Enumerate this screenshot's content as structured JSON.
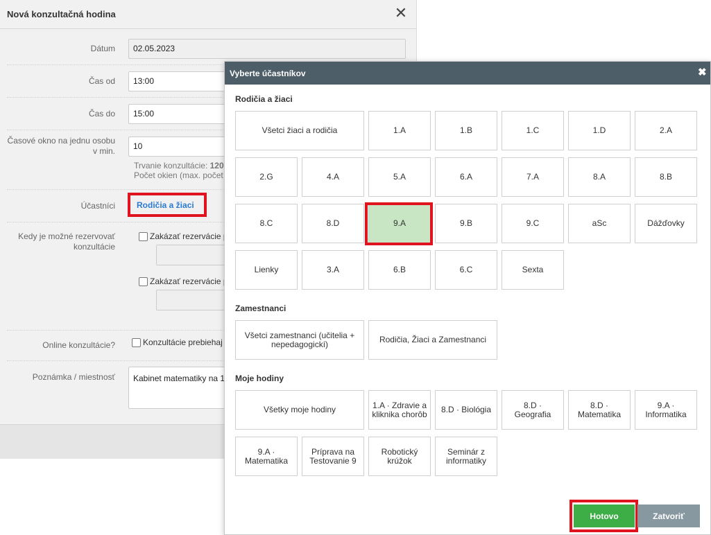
{
  "base": {
    "title": "Nová konzultačná hodina",
    "date_label": "Dátum",
    "date_value": "02.05.2023",
    "time_from_label": "Čas od",
    "time_from_value": "13:00",
    "time_to_label": "Čas do",
    "time_to_value": "15:00",
    "window_label": "Časové okno na jednu osobu v min.",
    "window_value": "10",
    "hint_duration_prefix": "Trvanie konzultácie: ",
    "hint_duration_value": "120",
    "hint_windows": "Počet okien (max. počet",
    "participants_label": "Účastníci",
    "participants_link": "Rodičia a žiaci",
    "reservation_label": "Kedy je možné rezervovať konzultácie",
    "reservation_check1": "Zakázať rezervácie p",
    "reservation_check2": "Zakázať rezervácie p",
    "online_label": "Online konzultácie?",
    "online_check": "Konzultácie prebiehaj",
    "note_label": "Poznámka / miestnosť",
    "note_value": "Kabinet matematiky na 1"
  },
  "modal": {
    "title": "Vyberte účastníkov",
    "close_glyph": "✖",
    "sections": {
      "parents_title": "Rodičia a žiaci",
      "staff_title": "Zamestnanci",
      "lessons_title": "Moje hodiny"
    },
    "parents_items": [
      "Všetci žiaci a rodičia",
      "1.A",
      "1.B",
      "1.C",
      "1.D",
      "2.A",
      "2.G",
      "4.A",
      "5.A",
      "6.A",
      "7.A",
      "8.A",
      "8.B",
      "8.C",
      "8.D",
      "9.A",
      "9.B",
      "9.C",
      "aSc",
      "Dážďovky",
      "Lienky",
      "3.A",
      "6.B",
      "6.C",
      "Sexta"
    ],
    "selected_item": "9.A",
    "staff_items": [
      "Všetci zamestnanci (učitelia + nepedagogickí)",
      "Rodičia, Žiaci a Zamestnanci"
    ],
    "lessons_items": [
      "Všetky moje hodiny",
      "1.A · Zdravie a kliknika chorôb",
      "8.D · Biológia",
      "8.D · Geografia",
      "8.D · Matematika",
      "9.A · Informatika",
      "9.A · Matematika",
      "Príprava na Testovanie 9",
      "Robotický krúžok",
      "Seminár z informatiky"
    ],
    "done_label": "Hotovo",
    "close_label": "Zatvoriť"
  },
  "colors": {
    "header_bg": "#4e5e68",
    "selected_bg": "#c8e6c3",
    "done_bg": "#3dae46",
    "close_bg": "#8798a0",
    "highlight": "#e0141e",
    "link": "#2a7ad2"
  }
}
